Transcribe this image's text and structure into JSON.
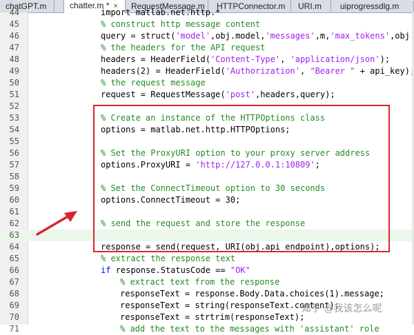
{
  "tabs": [
    {
      "label": "chatGPT.m",
      "active": false
    },
    {
      "label": "chatter.m *",
      "active": true
    },
    {
      "label": "RequestMessage.m",
      "active": false
    },
    {
      "label": "HTTPConnector.m",
      "active": false
    },
    {
      "label": "URI.m",
      "active": false
    },
    {
      "label": "uiprogressdlg.m",
      "active": false
    }
  ],
  "close_glyph": "×",
  "lines": [
    {
      "n": "44",
      "i": 1,
      "p": [
        [
          "import matlab.net.http.*",
          ""
        ]
      ]
    },
    {
      "n": "45",
      "i": 1,
      "p": [
        [
          "% construct http message content",
          "cm"
        ]
      ]
    },
    {
      "n": "46",
      "i": 1,
      "p": [
        [
          "query = struct(",
          ""
        ],
        [
          "'model'",
          "st"
        ],
        [
          ",obj.model,",
          ""
        ],
        [
          "'messages'",
          "st"
        ],
        [
          ",m,",
          ""
        ],
        [
          "'max_tokens'",
          "st"
        ],
        [
          ",obj.m",
          ""
        ]
      ]
    },
    {
      "n": "47",
      "i": 1,
      "p": [
        [
          "% the headers for the API request",
          "cm"
        ]
      ]
    },
    {
      "n": "48",
      "i": 1,
      "p": [
        [
          "headers = HeaderField(",
          ""
        ],
        [
          "'Content-Type'",
          "st"
        ],
        [
          ", ",
          ""
        ],
        [
          "'application/json'",
          "st"
        ],
        [
          ");",
          ""
        ]
      ]
    },
    {
      "n": "49",
      "i": 1,
      "p": [
        [
          "headers(2) = HeaderField(",
          ""
        ],
        [
          "'Authorization'",
          "st"
        ],
        [
          ", ",
          ""
        ],
        [
          "\"Bearer \"",
          "st"
        ],
        [
          " + api_key);",
          ""
        ]
      ]
    },
    {
      "n": "50",
      "i": 1,
      "p": [
        [
          "% the request message",
          "cm"
        ]
      ]
    },
    {
      "n": "51",
      "i": 1,
      "p": [
        [
          "request = RequestMessage(",
          ""
        ],
        [
          "'post'",
          "st"
        ],
        [
          ",headers,query);",
          ""
        ]
      ]
    },
    {
      "n": "52",
      "i": 1,
      "p": []
    },
    {
      "n": "53",
      "i": 1,
      "p": [
        [
          "% Create an instance of the HTTPOptions class",
          "cm"
        ]
      ]
    },
    {
      "n": "54",
      "i": 1,
      "p": [
        [
          "options = matlab.net.http.HTTPOptions;",
          ""
        ]
      ]
    },
    {
      "n": "55",
      "i": 1,
      "p": []
    },
    {
      "n": "56",
      "i": 1,
      "p": [
        [
          "% Set the ProxyURI option to your proxy server address",
          "cm"
        ]
      ]
    },
    {
      "n": "57",
      "i": 1,
      "p": [
        [
          "options.ProxyURI = ",
          ""
        ],
        [
          "'http://127.0.0.1:10809'",
          "st"
        ],
        [
          ";",
          ""
        ]
      ]
    },
    {
      "n": "58",
      "i": 1,
      "p": []
    },
    {
      "n": "59",
      "i": 1,
      "p": [
        [
          "% Set the ConnectTimeout option to 30 seconds",
          "cm"
        ]
      ]
    },
    {
      "n": "60",
      "i": 1,
      "p": [
        [
          "options.ConnectTimeout = 30;",
          ""
        ]
      ]
    },
    {
      "n": "61",
      "i": 1,
      "p": []
    },
    {
      "n": "62",
      "i": 1,
      "p": [
        [
          "% send the request and store the response",
          "cm"
        ]
      ]
    },
    {
      "n": "63",
      "i": 1,
      "hl": true,
      "p": []
    },
    {
      "n": "64",
      "i": 1,
      "p": [
        [
          "response = send(request, URI(obj.api_endpoint),options);",
          ""
        ]
      ]
    },
    {
      "n": "65",
      "i": 1,
      "p": [
        [
          "% extract the response text",
          "cm"
        ]
      ]
    },
    {
      "n": "66",
      "i": 1,
      "p": [
        [
          "if",
          "kw"
        ],
        [
          " response.StatusCode == ",
          ""
        ],
        [
          "\"OK\"",
          "st"
        ]
      ]
    },
    {
      "n": "67",
      "i": 2,
      "p": [
        [
          "% extract text from the response",
          "cm"
        ]
      ]
    },
    {
      "n": "68",
      "i": 2,
      "p": [
        [
          "responseText = response.Body.Data.choices(1).message;",
          ""
        ]
      ]
    },
    {
      "n": "69",
      "i": 2,
      "p": [
        [
          "responseText = string(responseText.content);",
          ""
        ]
      ]
    },
    {
      "n": "70",
      "i": 2,
      "p": [
        [
          "responseText = strtrim(responseText);",
          ""
        ]
      ]
    },
    {
      "n": "71",
      "i": 2,
      "p": [
        [
          "% add the text to the messages with 'assistant' role",
          "cm"
        ]
      ]
    }
  ],
  "watermark": "知乎 @我该怎么呢",
  "colors": {
    "highlight_box": "#d9232e",
    "arrow": "#d9232e",
    "comment": "#228b22",
    "string": "#a020f0",
    "keyword": "#0000ff"
  }
}
